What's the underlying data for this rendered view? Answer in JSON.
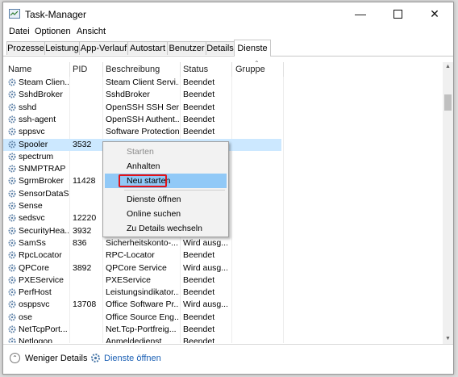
{
  "window": {
    "title": "Task-Manager",
    "minimize_icon": "minimize-icon",
    "maximize_icon": "maximize-icon",
    "close_icon": "close-icon"
  },
  "menubar": [
    "Datei",
    "Optionen",
    "Ansicht"
  ],
  "tabs": [
    {
      "label": "Prozesse",
      "active": false
    },
    {
      "label": "Leistung",
      "active": false
    },
    {
      "label": "App-Verlauf",
      "active": false
    },
    {
      "label": "Autostart",
      "active": false
    },
    {
      "label": "Benutzer",
      "active": false
    },
    {
      "label": "Details",
      "active": false
    },
    {
      "label": "Dienste",
      "active": true
    }
  ],
  "columns": {
    "name": "Name",
    "pid": "PID",
    "description": "Beschreibung",
    "status": "Status",
    "group": "Gruppe"
  },
  "rows": [
    {
      "name": "Steam Clien...",
      "pid": "",
      "description": "Steam Client Servi...",
      "status": "Beendet",
      "selected": false
    },
    {
      "name": "SshdBroker",
      "pid": "",
      "description": "SshdBroker",
      "status": "Beendet",
      "selected": false
    },
    {
      "name": "sshd",
      "pid": "",
      "description": "OpenSSH SSH Ser...",
      "status": "Beendet",
      "selected": false
    },
    {
      "name": "ssh-agent",
      "pid": "",
      "description": "OpenSSH Authent...",
      "status": "Beendet",
      "selected": false
    },
    {
      "name": "sppsvc",
      "pid": "",
      "description": "Software Protection",
      "status": "Beendet",
      "selected": false
    },
    {
      "name": "Spooler",
      "pid": "3532",
      "description": "",
      "status": "",
      "selected": true
    },
    {
      "name": "spectrum",
      "pid": "",
      "description": "",
      "status": "",
      "selected": false
    },
    {
      "name": "SNMPTRAP",
      "pid": "",
      "description": "",
      "status": "",
      "selected": false
    },
    {
      "name": "SgrmBroker",
      "pid": "11428",
      "description": "",
      "status": "",
      "selected": false
    },
    {
      "name": "SensorDataS...",
      "pid": "",
      "description": "",
      "status": "",
      "selected": false
    },
    {
      "name": "Sense",
      "pid": "",
      "description": "",
      "status": "",
      "selected": false
    },
    {
      "name": "sedsvc",
      "pid": "12220",
      "description": "",
      "status": "",
      "selected": false
    },
    {
      "name": "SecurityHea...",
      "pid": "3932",
      "description": "",
      "status": "",
      "selected": false
    },
    {
      "name": "SamSs",
      "pid": "836",
      "description": "Sicherheitskonto-...",
      "status": "Wird ausg...",
      "selected": false
    },
    {
      "name": "RpcLocator",
      "pid": "",
      "description": "RPC-Locator",
      "status": "Beendet",
      "selected": false
    },
    {
      "name": "QPCore",
      "pid": "3892",
      "description": "QPCore Service",
      "status": "Wird ausg...",
      "selected": false
    },
    {
      "name": "PXEService",
      "pid": "",
      "description": "PXEService",
      "status": "Beendet",
      "selected": false
    },
    {
      "name": "PerfHost",
      "pid": "",
      "description": "Leistungsindikator...",
      "status": "Beendet",
      "selected": false
    },
    {
      "name": "osppsvc",
      "pid": "13708",
      "description": "Office Software Pr...",
      "status": "Wird ausg...",
      "selected": false
    },
    {
      "name": "ose",
      "pid": "",
      "description": "Office  Source Eng...",
      "status": "Beendet",
      "selected": false
    },
    {
      "name": "NetTcpPort...",
      "pid": "",
      "description": "Net.Tcp-Portfreig...",
      "status": "Beendet",
      "selected": false
    },
    {
      "name": "Netlogon",
      "pid": "",
      "description": "Anmeldedienst",
      "status": "Beendet",
      "selected": false
    }
  ],
  "context_menu": {
    "items": [
      {
        "label": "Starten",
        "disabled": true,
        "highlighted": false,
        "separator_after": false
      },
      {
        "label": "Anhalten",
        "disabled": false,
        "highlighted": false,
        "separator_after": false
      },
      {
        "label": "Neu starten",
        "disabled": false,
        "highlighted": true,
        "separator_after": true
      },
      {
        "label": "Dienste öffnen",
        "disabled": false,
        "highlighted": false,
        "separator_after": false
      },
      {
        "label": "Online suchen",
        "disabled": false,
        "highlighted": false,
        "separator_after": false
      },
      {
        "label": "Zu Details wechseln",
        "disabled": false,
        "highlighted": false,
        "separator_after": false
      }
    ]
  },
  "footer": {
    "fewer_details": "Weniger Details",
    "open_services": "Dienste öffnen"
  },
  "colors": {
    "selection": "#cce8ff",
    "menu_hover": "#91c9f7",
    "highlight_box": "#e0141b",
    "link": "#1a5fb4"
  }
}
